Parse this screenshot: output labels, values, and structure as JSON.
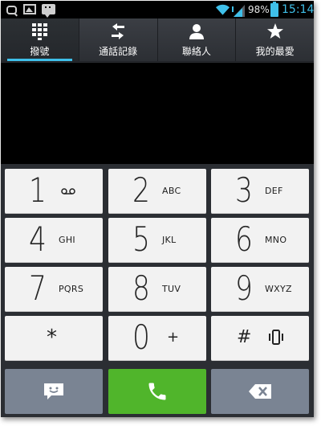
{
  "status_bar": {
    "battery_percent": "98%",
    "time": "15:14",
    "icons": [
      "search-icon",
      "image-icon",
      "messenger-icon",
      "wifi-icon",
      "signal-icon",
      "battery-icon"
    ]
  },
  "tabs": [
    {
      "label": "撥號",
      "icon": "dialpad-icon",
      "active": true
    },
    {
      "label": "通話記錄",
      "icon": "call-log-icon",
      "active": false
    },
    {
      "label": "聯絡人",
      "icon": "contact-icon",
      "active": false
    },
    {
      "label": "我的最愛",
      "icon": "star-icon",
      "active": false
    }
  ],
  "display": {
    "number": ""
  },
  "keypad": {
    "keys": [
      {
        "digit": "1",
        "letters": "",
        "icon": "voicemail-icon"
      },
      {
        "digit": "2",
        "letters": "ABC"
      },
      {
        "digit": "3",
        "letters": "DEF"
      },
      {
        "digit": "4",
        "letters": "GHI"
      },
      {
        "digit": "5",
        "letters": "JKL"
      },
      {
        "digit": "6",
        "letters": "MNO"
      },
      {
        "digit": "7",
        "letters": "PQRS"
      },
      {
        "digit": "8",
        "letters": "TUV"
      },
      {
        "digit": "9",
        "letters": "WXYZ"
      },
      {
        "digit": "*",
        "letters": ""
      },
      {
        "digit": "0",
        "letters": "+"
      },
      {
        "digit": "#",
        "letters": "",
        "icon": "vibrate-icon"
      }
    ]
  },
  "bottom_actions": [
    {
      "icon": "message-icon",
      "color": "#7a8493"
    },
    {
      "icon": "phone-icon",
      "color": "#50b52b"
    },
    {
      "icon": "backspace-icon",
      "color": "#7a8493"
    }
  ],
  "colors": {
    "accent": "#3fc0ea",
    "call_green": "#50b52b",
    "action_gray": "#7a8493"
  }
}
